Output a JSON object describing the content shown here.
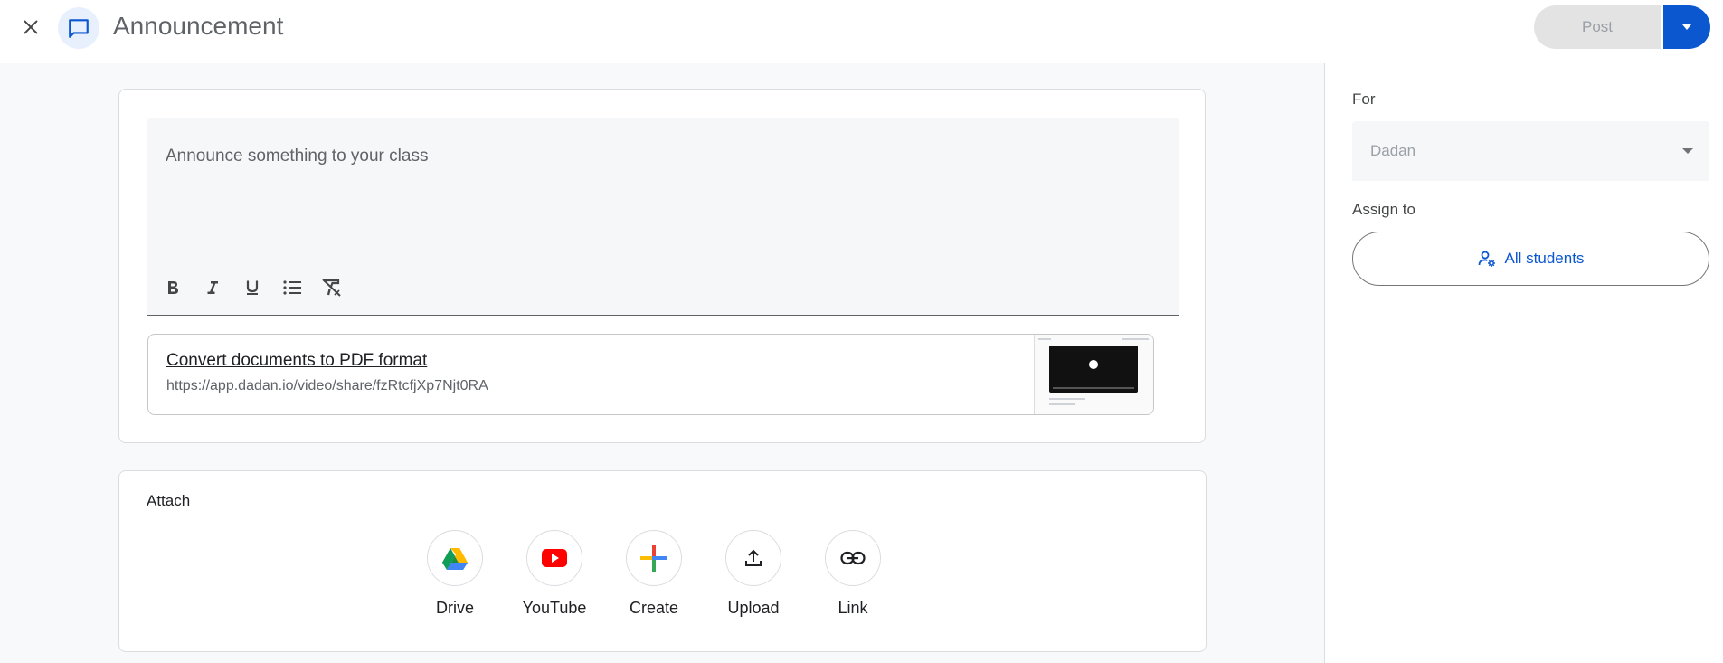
{
  "header": {
    "title": "Announcement",
    "post_label": "Post"
  },
  "editor": {
    "placeholder": "Announce something to your class"
  },
  "link_attachment": {
    "title": "Convert documents to PDF format",
    "url": "https://app.dadan.io/video/share/fzRtcfjXp7Njt0RA"
  },
  "attach": {
    "title": "Attach",
    "items": [
      {
        "label": "Drive",
        "icon": "drive-icon"
      },
      {
        "label": "YouTube",
        "icon": "youtube-icon"
      },
      {
        "label": "Create",
        "icon": "create-plus-icon"
      },
      {
        "label": "Upload",
        "icon": "upload-icon"
      },
      {
        "label": "Link",
        "icon": "link-icon"
      }
    ]
  },
  "sidebar": {
    "for_label": "For",
    "for_value": "Dadan",
    "assign_label": "Assign to",
    "assign_value": "All students"
  },
  "colors": {
    "accent": "#0b57d0",
    "badge_bg": "#e8f0fe",
    "page_bg": "#f8f9fa"
  }
}
